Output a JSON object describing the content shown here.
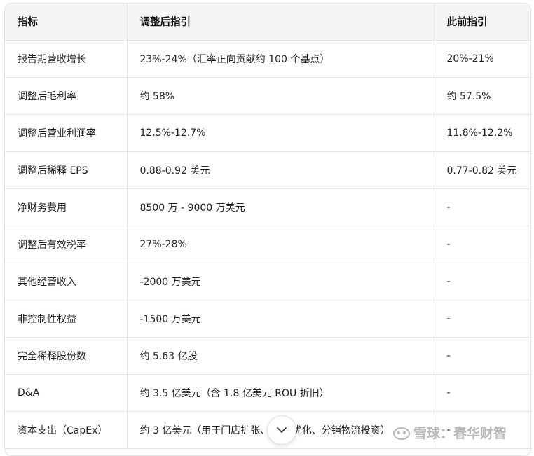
{
  "table": {
    "headers": [
      "指标",
      "调整后指引",
      "此前指引"
    ],
    "rows": [
      [
        "报告期营收增长",
        "23%-24%（汇率正向贡献约 100 个基点）",
        "20%-21%"
      ],
      [
        "调整后毛利率",
        "约 58%",
        "约 57.5%"
      ],
      [
        "调整后营业利润率",
        "12.5%-12.7%",
        "11.8%-12.2%"
      ],
      [
        "调整后稀释 EPS",
        "0.88-0.92 美元",
        "0.77-0.82 美元"
      ],
      [
        "净财务费用",
        "8500 万 - 9000 万美元",
        "-"
      ],
      [
        "调整后有效税率",
        "27%-28%",
        "-"
      ],
      [
        "其他经营收入",
        "-2000 万美元",
        "-"
      ],
      [
        "非控制性权益",
        "-1500 万美元",
        "-"
      ],
      [
        "完全稀释股份数",
        "约 5.63 亿股",
        "-"
      ],
      [
        "D&A",
        "约 3.5 亿美元（含 1.8 亿美元 ROU 折旧）",
        "-"
      ],
      [
        "资本支出（CapEx）",
        "约 3 亿美元（用于门店扩张、ERP 优化、分销物流投资）",
        "-"
      ]
    ]
  },
  "watermark": {
    "text": "雪球：春华财智",
    "icon": "snowball-logo-icon"
  },
  "scroll_button": {
    "icon": "chevron-down-icon"
  }
}
